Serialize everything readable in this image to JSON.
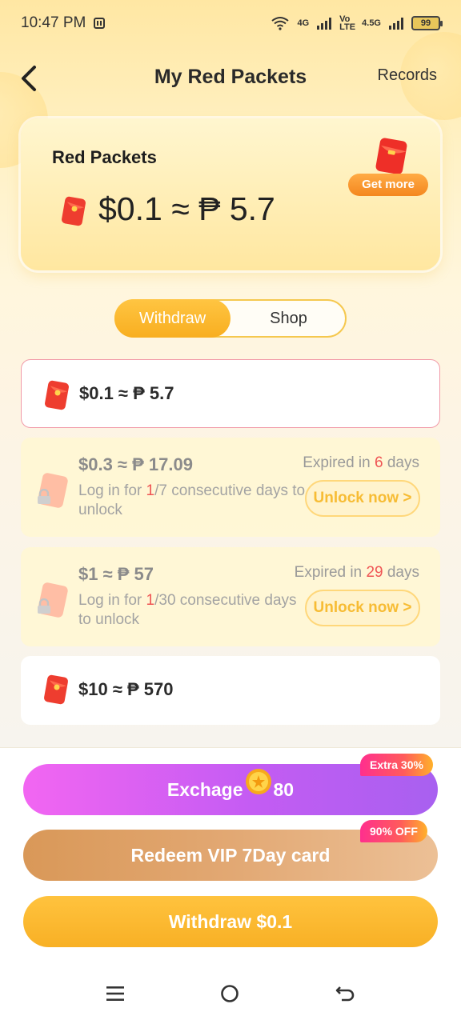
{
  "status_bar": {
    "time": "10:47 PM",
    "network_a": "4G",
    "network_b": "Vo LTE",
    "network_c": "4.5G",
    "battery": "99"
  },
  "header": {
    "title": "My Red Packets",
    "records_label": "Records"
  },
  "balance_card": {
    "title": "Red Packets",
    "amount": "$0.1 ≈ ₱ 5.7",
    "get_more_label": "Get more"
  },
  "tabs": [
    {
      "label": "Withdraw",
      "active": true
    },
    {
      "label": "Shop",
      "active": false
    }
  ],
  "packets": [
    {
      "amount": "$0.1 ≈ ₱ 5.7",
      "state": "selected"
    },
    {
      "amount": "$0.3 ≈ ₱ 17.09",
      "state": "locked",
      "expire_prefix": "Expired in",
      "expire_days": "6",
      "expire_suffix": "days",
      "unlock_prefix": "Log in for",
      "unlock_progress": "1",
      "unlock_suffix": "/7 consecutive days to unlock",
      "unlock_label": "Unlock now >"
    },
    {
      "amount": "$1 ≈ ₱ 57",
      "state": "locked",
      "expire_prefix": "Expired in",
      "expire_days": "29",
      "expire_suffix": "days",
      "unlock_prefix": "Log in for",
      "unlock_progress": "1",
      "unlock_suffix": "/30 consecutive days to unlock",
      "unlock_label": "Unlock now >"
    },
    {
      "amount": "$10 ≈ ₱ 570",
      "state": "normal"
    }
  ],
  "actions": {
    "exchange_label": "Exchage",
    "exchange_cost": "80",
    "exchange_tag": "Extra 30%",
    "vip_label": "Redeem VIP 7Day card",
    "vip_tag": "90% OFF",
    "withdraw_label": "Withdraw $0.1"
  },
  "colors": {
    "accent": "#f8ae20",
    "highlight_red": "#ef5454",
    "exchange_purple": "#c45cf3",
    "vip_tan": "#e2a873"
  },
  "icons": {
    "back": "chevron-left-icon",
    "packet": "red-packet-icon",
    "lock": "lock-icon",
    "coin": "coin-icon",
    "nav": [
      "menu-icon",
      "home-circle-icon",
      "back-arrow-icon"
    ]
  }
}
